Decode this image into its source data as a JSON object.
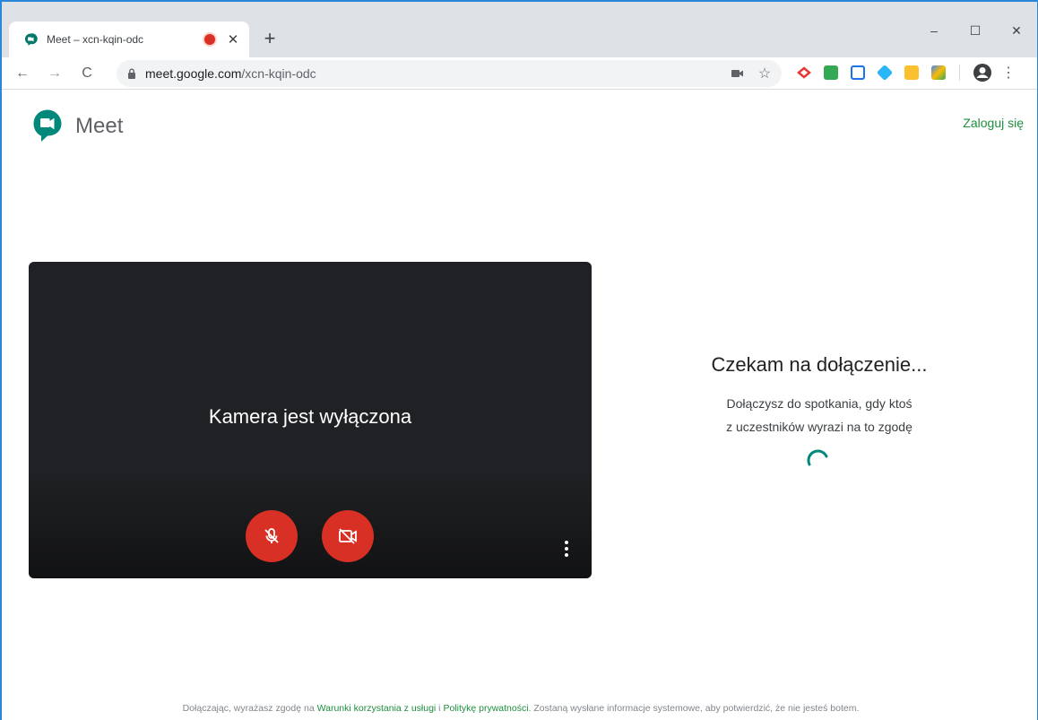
{
  "browser": {
    "tab_title": "Meet – xcn-kqin-odc",
    "new_tab_label": "+",
    "url_domain": "meet.google.com",
    "url_path": "/xcn-kqin-odc",
    "window_controls": {
      "minimize": "–",
      "maximize": "☐",
      "close": "✕"
    },
    "tab_close": "✕",
    "nav": {
      "back": "←",
      "forward": "→",
      "reload": "C"
    },
    "menu": "⋮"
  },
  "header": {
    "app_name": "Meet",
    "signin_label": "Zaloguj się"
  },
  "preview": {
    "camera_off_text": "Kamera jest wyłączona"
  },
  "waiting": {
    "title": "Czekam na dołączenie...",
    "line1": "Dołączysz do spotkania, gdy ktoś",
    "line2": "z uczestników wyrazi na to zgodę"
  },
  "footer": {
    "prefix": "Dołączając, wyrażasz zgodę na ",
    "terms_link": "Warunki korzystania z usługi",
    "and": " i ",
    "privacy_link": "Politykę prywatności",
    "suffix": ". Zostaną wysłane informacje systemowe, aby potwierdzić, że nie jesteś botem."
  },
  "colors": {
    "accent_green": "#1e8e3e",
    "mute_red": "#d93025",
    "preview_bg": "#202124"
  },
  "icons": {
    "mic": "mic-off-icon",
    "cam": "camera-off-icon",
    "more": "more-vert-icon"
  }
}
